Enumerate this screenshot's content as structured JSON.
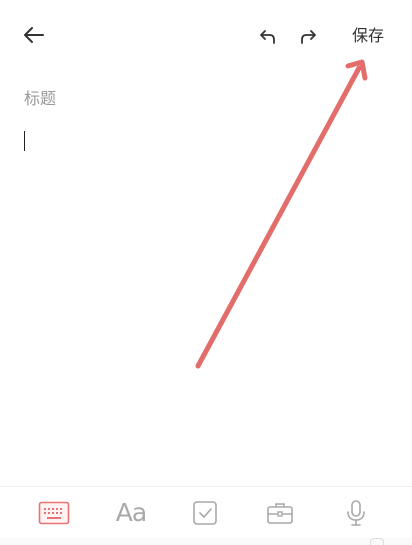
{
  "header": {
    "back_icon": "back-arrow-icon",
    "undo_icon": "undo-icon",
    "redo_icon": "redo-icon",
    "save_label": "保存"
  },
  "editor": {
    "title_placeholder": "标题",
    "body_text": ""
  },
  "toolbar": {
    "items": [
      {
        "icon": "keyboard-icon",
        "active": true
      },
      {
        "icon": "text-format-icon",
        "label": "Aa",
        "active": false
      },
      {
        "icon": "checkbox-icon",
        "active": false
      },
      {
        "icon": "briefcase-icon",
        "active": false
      },
      {
        "icon": "microphone-icon",
        "active": false
      }
    ]
  },
  "colors": {
    "accent": "#e77472",
    "icon_default": "#a9a9a9",
    "text": "#333333",
    "placeholder": "#9a9a9a",
    "annotation_arrow": "#e26d6b"
  }
}
